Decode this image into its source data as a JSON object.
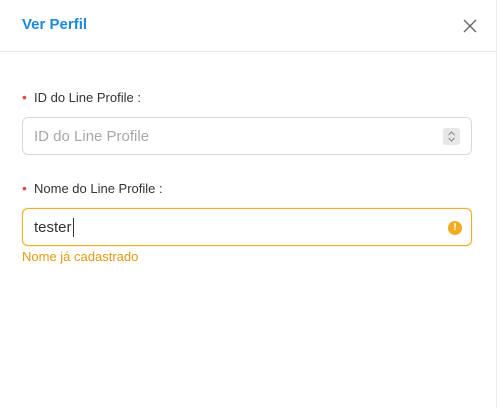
{
  "header": {
    "title": "Ver Perfil",
    "close_icon": "close-icon"
  },
  "form": {
    "required_mark": "•",
    "id_field": {
      "label": "ID do Line Profile",
      "colon": ":",
      "placeholder": "ID do Line Profile",
      "value": ""
    },
    "name_field": {
      "label": "Nome do Line Profile",
      "colon": ":",
      "value": "tester",
      "status_icon": "warning-icon",
      "error": "Nome já cadastrado"
    }
  },
  "colors": {
    "accent": "#1e88d8",
    "required": "#e34b4b",
    "warning": "#f0ad20",
    "error_text": "#e39a15"
  }
}
